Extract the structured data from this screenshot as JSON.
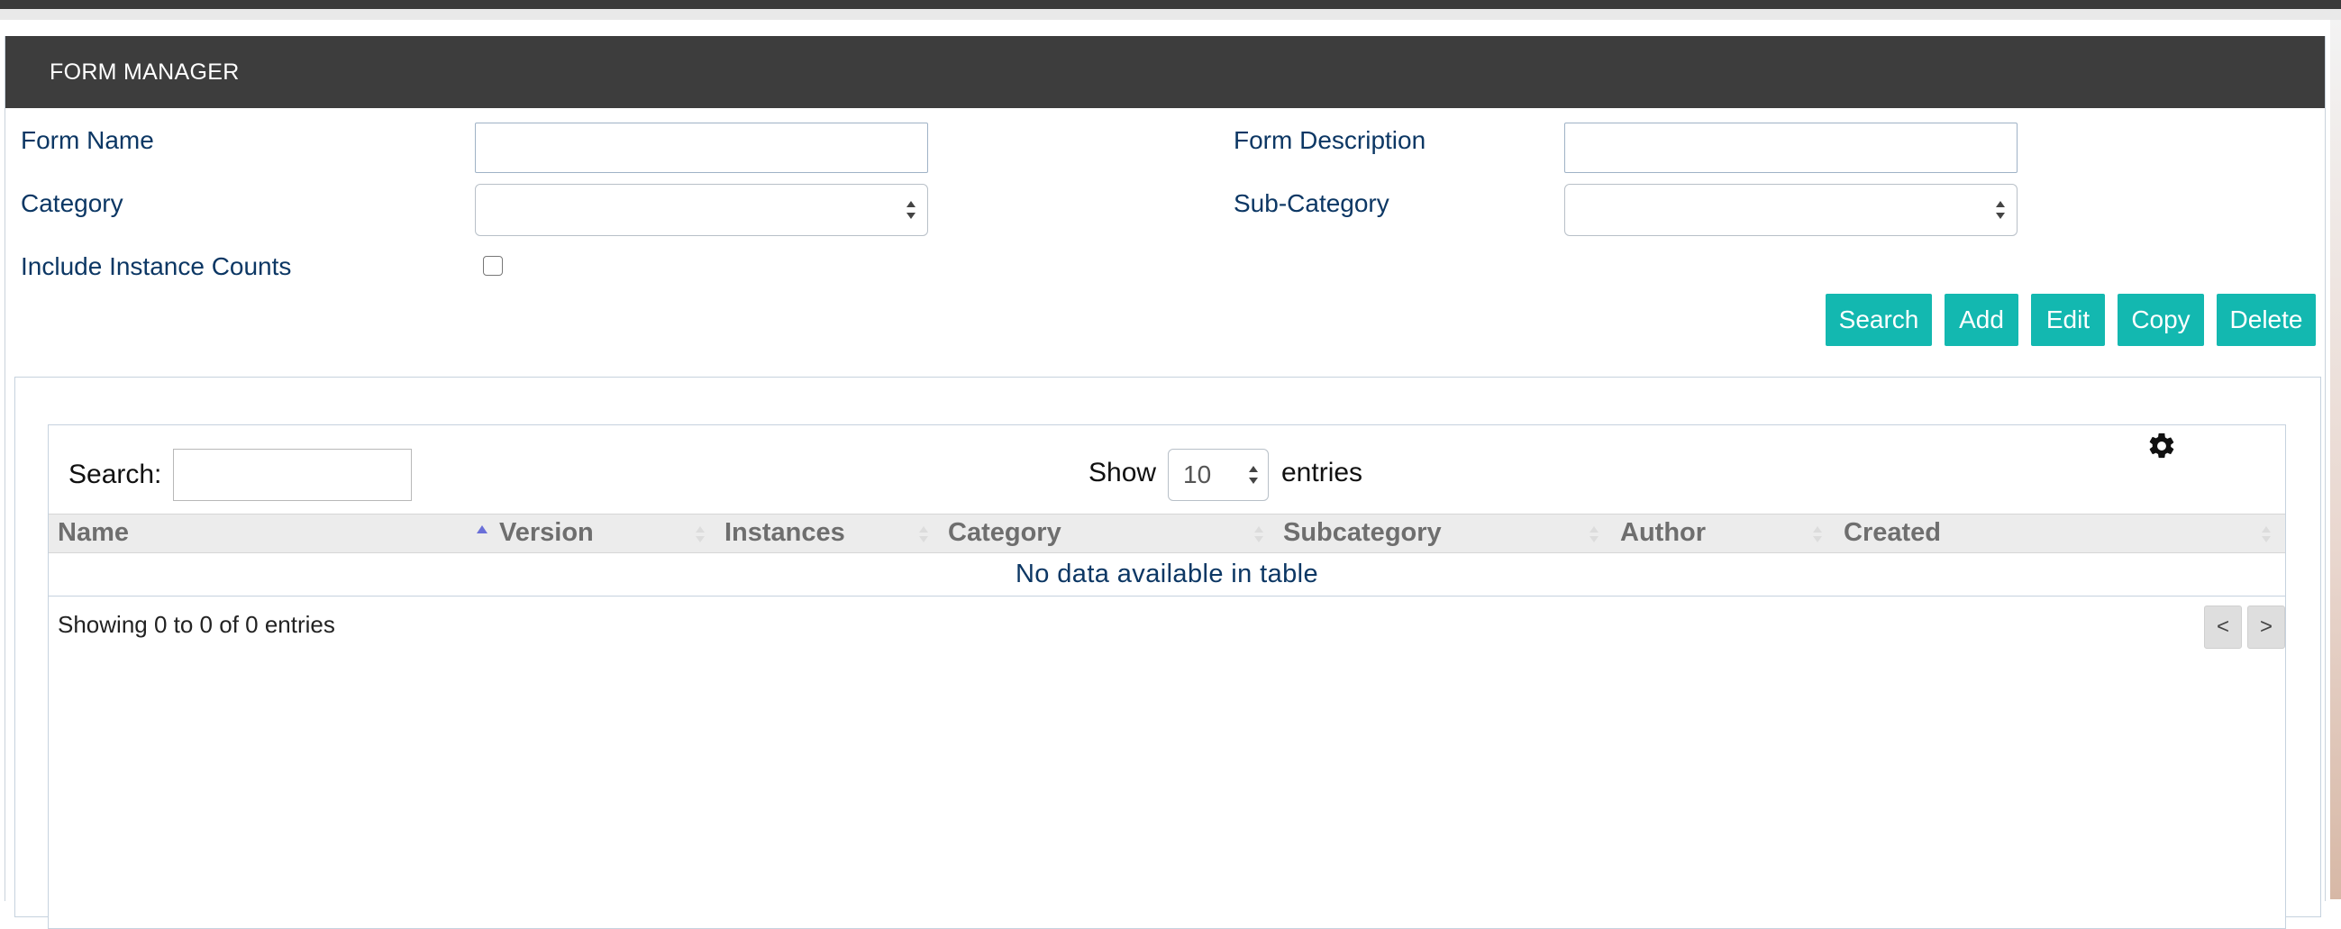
{
  "header": {
    "title": "FORM MANAGER"
  },
  "form": {
    "form_name_label": "Form Name",
    "form_name_value": "",
    "form_description_label": "Form Description",
    "form_description_value": "",
    "category_label": "Category",
    "category_selected": "",
    "subcategory_label": "Sub-Category",
    "subcategory_selected": "",
    "include_counts_label": "Include Instance Counts",
    "include_counts_checked": false
  },
  "toolbar": {
    "search_label": "Search",
    "add_label": "Add",
    "edit_label": "Edit",
    "copy_label": "Copy",
    "delete_label": "Delete"
  },
  "table": {
    "search_label": "Search:",
    "search_value": "",
    "show_label": "Show",
    "page_size": "10",
    "entries_label": "entries",
    "columns": [
      "Name",
      "Version",
      "Instances",
      "Category",
      "Subcategory",
      "Author",
      "Created"
    ],
    "empty_message": "No data available in table",
    "info": "Showing 0 to 0 of 0 entries",
    "prev_label": "<",
    "next_label": ">"
  },
  "colors": {
    "header_bg": "#3d3d3d",
    "accent": "#13b8b0",
    "label_text": "#0c3764"
  },
  "icons": {
    "settings": "gear-icon",
    "sort_active": "sort-asc-icon",
    "sort_inactive": "sort-both-icon",
    "select": "select-arrows-icon"
  }
}
